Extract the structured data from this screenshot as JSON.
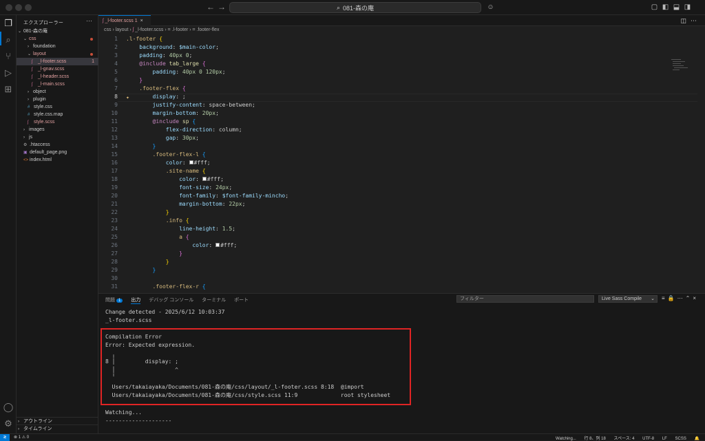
{
  "titlebar": {
    "back_icon": "arrow-left-icon",
    "forward_icon": "arrow-right-icon",
    "search_text": "081-森の庵"
  },
  "activity": [
    "files-icon",
    "search-icon",
    "source-control-icon",
    "run-debug-icon",
    "extensions-icon",
    "account-icon",
    "gear-icon"
  ],
  "explorer": {
    "title": "エクスプローラー",
    "more": "···",
    "root": "081-森の庵",
    "items": [
      {
        "label": "css",
        "depth": 1,
        "type": "folder",
        "open": true,
        "modified": true
      },
      {
        "label": "foundation",
        "depth": 2,
        "type": "folder",
        "open": false
      },
      {
        "label": "layout",
        "depth": 2,
        "type": "folder",
        "open": true,
        "modified": true
      },
      {
        "label": "_l-footer.scss",
        "depth": 3,
        "type": "scss",
        "selected": true,
        "badge": "1"
      },
      {
        "label": "_l-gnav.scss",
        "depth": 3,
        "type": "scss"
      },
      {
        "label": "_l-header.scss",
        "depth": 3,
        "type": "scss"
      },
      {
        "label": "_l-main.scss",
        "depth": 3,
        "type": "scss"
      },
      {
        "label": "object",
        "depth": 2,
        "type": "folder",
        "open": false
      },
      {
        "label": "plugin",
        "depth": 2,
        "type": "folder",
        "open": false
      },
      {
        "label": "style.css",
        "depth": 2,
        "type": "css"
      },
      {
        "label": "style.css.map",
        "depth": 2,
        "type": "map"
      },
      {
        "label": "style.scss",
        "depth": 2,
        "type": "scss"
      },
      {
        "label": "images",
        "depth": 1,
        "type": "folder",
        "open": false
      },
      {
        "label": "js",
        "depth": 1,
        "type": "folder",
        "open": false
      },
      {
        "label": ".htaccess",
        "depth": 1,
        "type": "gear"
      },
      {
        "label": "default_page.png",
        "depth": 1,
        "type": "image"
      },
      {
        "label": "index.html",
        "depth": 1,
        "type": "html"
      }
    ],
    "outline": "アウトライン",
    "timeline": "タイムライン"
  },
  "editor": {
    "tab_label": "_l-footer.scss",
    "tab_badge": "1",
    "breadcrumb": [
      "css",
      "layout",
      "_l-footer.scss",
      ".l-footer",
      ".footer-flex"
    ],
    "current_line": 8
  },
  "panel": {
    "tabs": [
      "問題",
      "出力",
      "デバッグ コンソール",
      "ターミナル",
      "ポート"
    ],
    "problems_count": "1",
    "filter_placeholder": "フィルター",
    "output_channel": "Live Sass Compile",
    "lines": [
      "Change detected - 2025/6/12 10:03:37",
      "_l-footer.scss",
      "",
      "Compilation Error",
      "Error: Expected expression.",
      "  ╷",
      "8 │         display: ;",
      "  │                  ^",
      "  ╵",
      "  Users/takaiayaka/Documents/081-森の庵/css/layout/_l-footer.scss 8:18  @import",
      "  Users/takaiayaka/Documents/081-森の庵/css/style.scss 11:9             root stylesheet",
      "",
      "Watching...",
      "--------------------"
    ]
  },
  "statusbar": {
    "problems": "⊗ 1 ⚠ 0",
    "watching": "Watching...",
    "position": "行 8、列 18",
    "spaces": "スペース: 4",
    "encoding": "UTF-8",
    "eol": "LF",
    "language": "SCSS"
  }
}
